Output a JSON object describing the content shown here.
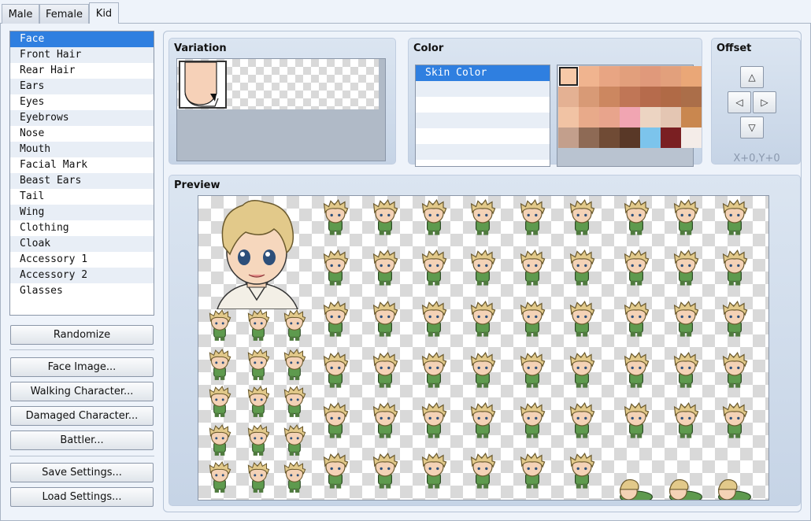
{
  "tabs": [
    {
      "label": "Male"
    },
    {
      "label": "Female"
    },
    {
      "label": "Kid",
      "active": true
    }
  ],
  "parts": [
    "Face",
    "Front Hair",
    "Rear Hair",
    "Ears",
    "Eyes",
    "Eyebrows",
    "Nose",
    "Mouth",
    "Facial Mark",
    "Beast Ears",
    "Tail",
    "Wing",
    "Clothing",
    "Cloak",
    "Accessory 1",
    "Accessory 2",
    "Glasses"
  ],
  "selected_part": "Face",
  "buttons": {
    "randomize": "Randomize",
    "face_image": "Face Image...",
    "walking_character": "Walking Character...",
    "damaged_character": "Damaged Character...",
    "battler": "Battler...",
    "save_settings": "Save Settings...",
    "load_settings": "Load Settings..."
  },
  "variation": {
    "title": "Variation"
  },
  "color": {
    "title": "Color",
    "items": [
      "Skin Color"
    ],
    "swatches": [
      [
        "#f7c9a8",
        "#f0b48f",
        "#e8a583",
        "#e29f7c",
        "#e0997b",
        "#e2a07c",
        "#eaa777"
      ],
      [
        "#e4b193",
        "#d89a76",
        "#cc8760",
        "#c07656",
        "#b66b4c",
        "#b06a46",
        "#ab6e49"
      ],
      [
        "#f1c3a4",
        "#e8aa8a",
        "#e8a48c",
        "#f1a5b2",
        "#ecd4c2",
        "#e4c6b3",
        "#c9874f"
      ],
      [
        "#c39f8c",
        "#8e6a55",
        "#704b35",
        "#593827",
        "#7cc4ec",
        "#7a1f22",
        "#f4ece8"
      ]
    ],
    "selected_swatch": [
      0,
      0
    ]
  },
  "offset": {
    "title": "Offset",
    "up": "△",
    "left": "◁",
    "right": "▷",
    "down": "▽",
    "readout": "X+0,Y+0"
  },
  "preview": {
    "title": "Preview"
  },
  "colors": {
    "accent": "#2f7fe0",
    "hair": "#e2c98a",
    "shirt": "#5e9a4e",
    "skin": "#f4d2b6"
  }
}
